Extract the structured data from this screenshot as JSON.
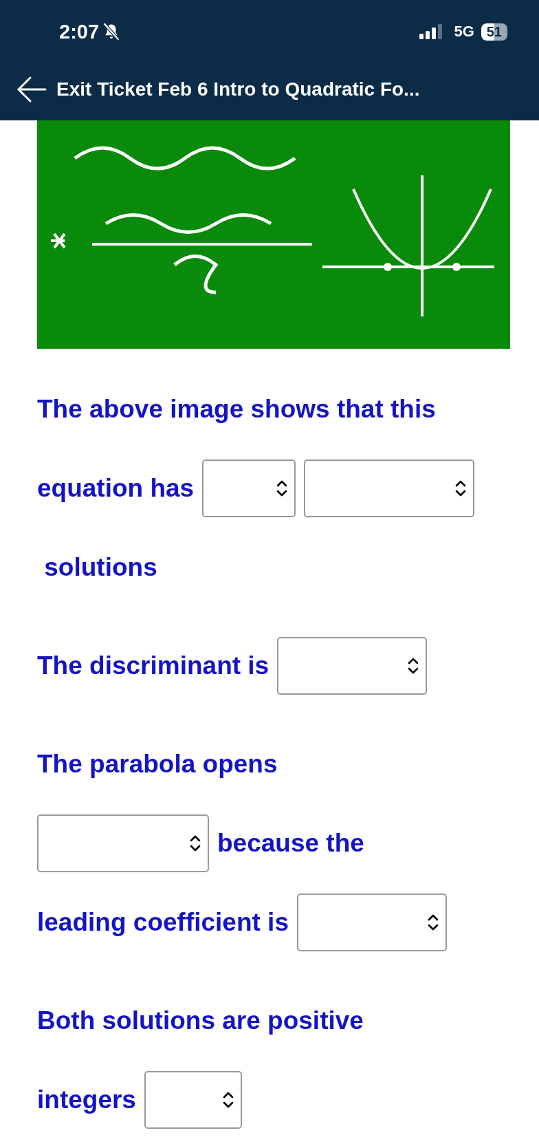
{
  "status_bar": {
    "time": "2:07",
    "network": "5G",
    "battery": "51"
  },
  "header": {
    "title": "Exit Ticket Feb 6 Intro to Quadratic Fo..."
  },
  "paragraphs": [
    {
      "lines": [
        [
          {
            "kind": "text",
            "text": "The above image shows that this"
          }
        ],
        [
          {
            "kind": "text",
            "text": "equation has"
          },
          {
            "kind": "select"
          },
          {
            "kind": "select"
          }
        ],
        [
          {
            "kind": "text",
            "text": " solutions"
          }
        ]
      ]
    },
    {
      "lines": [
        [
          {
            "kind": "text",
            "text": "The discriminant is"
          },
          {
            "kind": "select"
          }
        ]
      ]
    },
    {
      "lines": [
        [
          {
            "kind": "text",
            "text": "The parabola opens"
          }
        ],
        [
          {
            "kind": "select"
          },
          {
            "kind": "text",
            "text": "because the"
          }
        ],
        [
          {
            "kind": "text",
            "text": "leading coefficient is"
          },
          {
            "kind": "select"
          }
        ]
      ]
    },
    {
      "lines": [
        [
          {
            "kind": "text",
            "text": "Both solutions are positive"
          }
        ],
        [
          {
            "kind": "text",
            "text": "integers"
          },
          {
            "kind": "select"
          }
        ]
      ]
    }
  ]
}
